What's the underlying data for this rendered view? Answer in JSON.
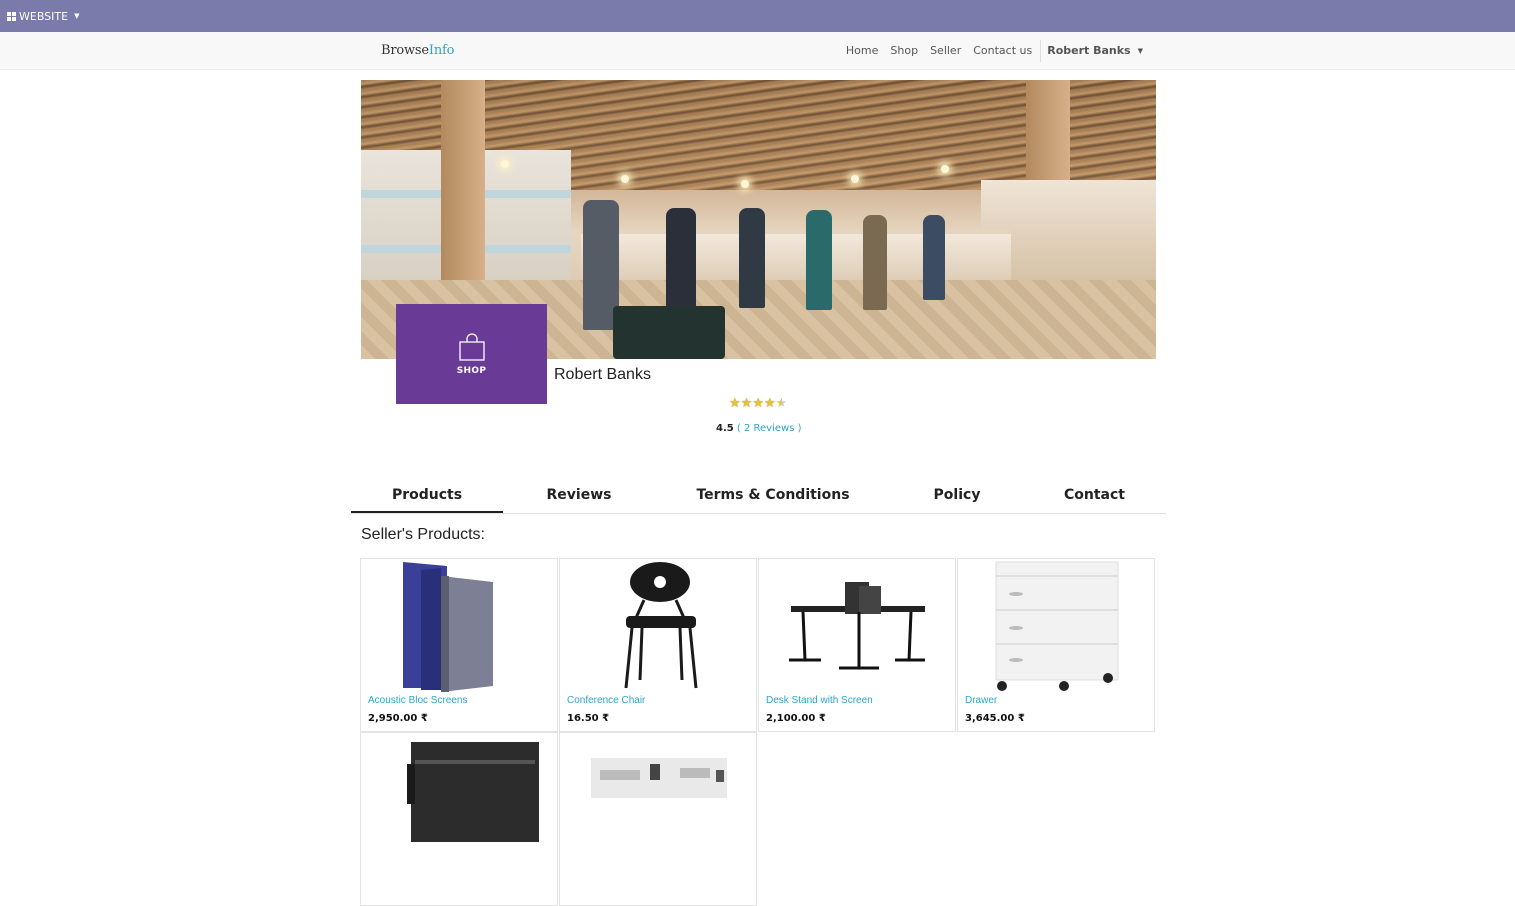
{
  "adminbar": {
    "website_label": "WEBSITE"
  },
  "navbar": {
    "brand_part1": "Browse",
    "brand_part2": "Info",
    "links": [
      "Home",
      "Shop",
      "Seller",
      "Contact us"
    ],
    "user": "Robert Banks"
  },
  "seller": {
    "logo_label": "SHOP",
    "name": "Robert Banks",
    "rating": "4.5",
    "reviews": "( 2 Reviews )",
    "stars": 4.5
  },
  "tabs": [
    {
      "label": "Products",
      "active": true
    },
    {
      "label": "Reviews",
      "active": false
    },
    {
      "label": "Terms & Conditions",
      "active": false
    },
    {
      "label": "Policy",
      "active": false
    },
    {
      "label": "Contact",
      "active": false
    }
  ],
  "section_title": "Seller's Products:",
  "products": [
    {
      "name": "Acoustic Bloc Screens",
      "price": "2,950.00 ₹"
    },
    {
      "name": "Conference Chair",
      "price": "16.50 ₹"
    },
    {
      "name": "Desk Stand with Screen",
      "price": "2,100.00 ₹"
    },
    {
      "name": "Drawer",
      "price": "3,645.00 ₹"
    }
  ],
  "colors": {
    "adminbar": "#7a7aab",
    "logo": "#6a3a97",
    "link": "#2aa6c9"
  }
}
